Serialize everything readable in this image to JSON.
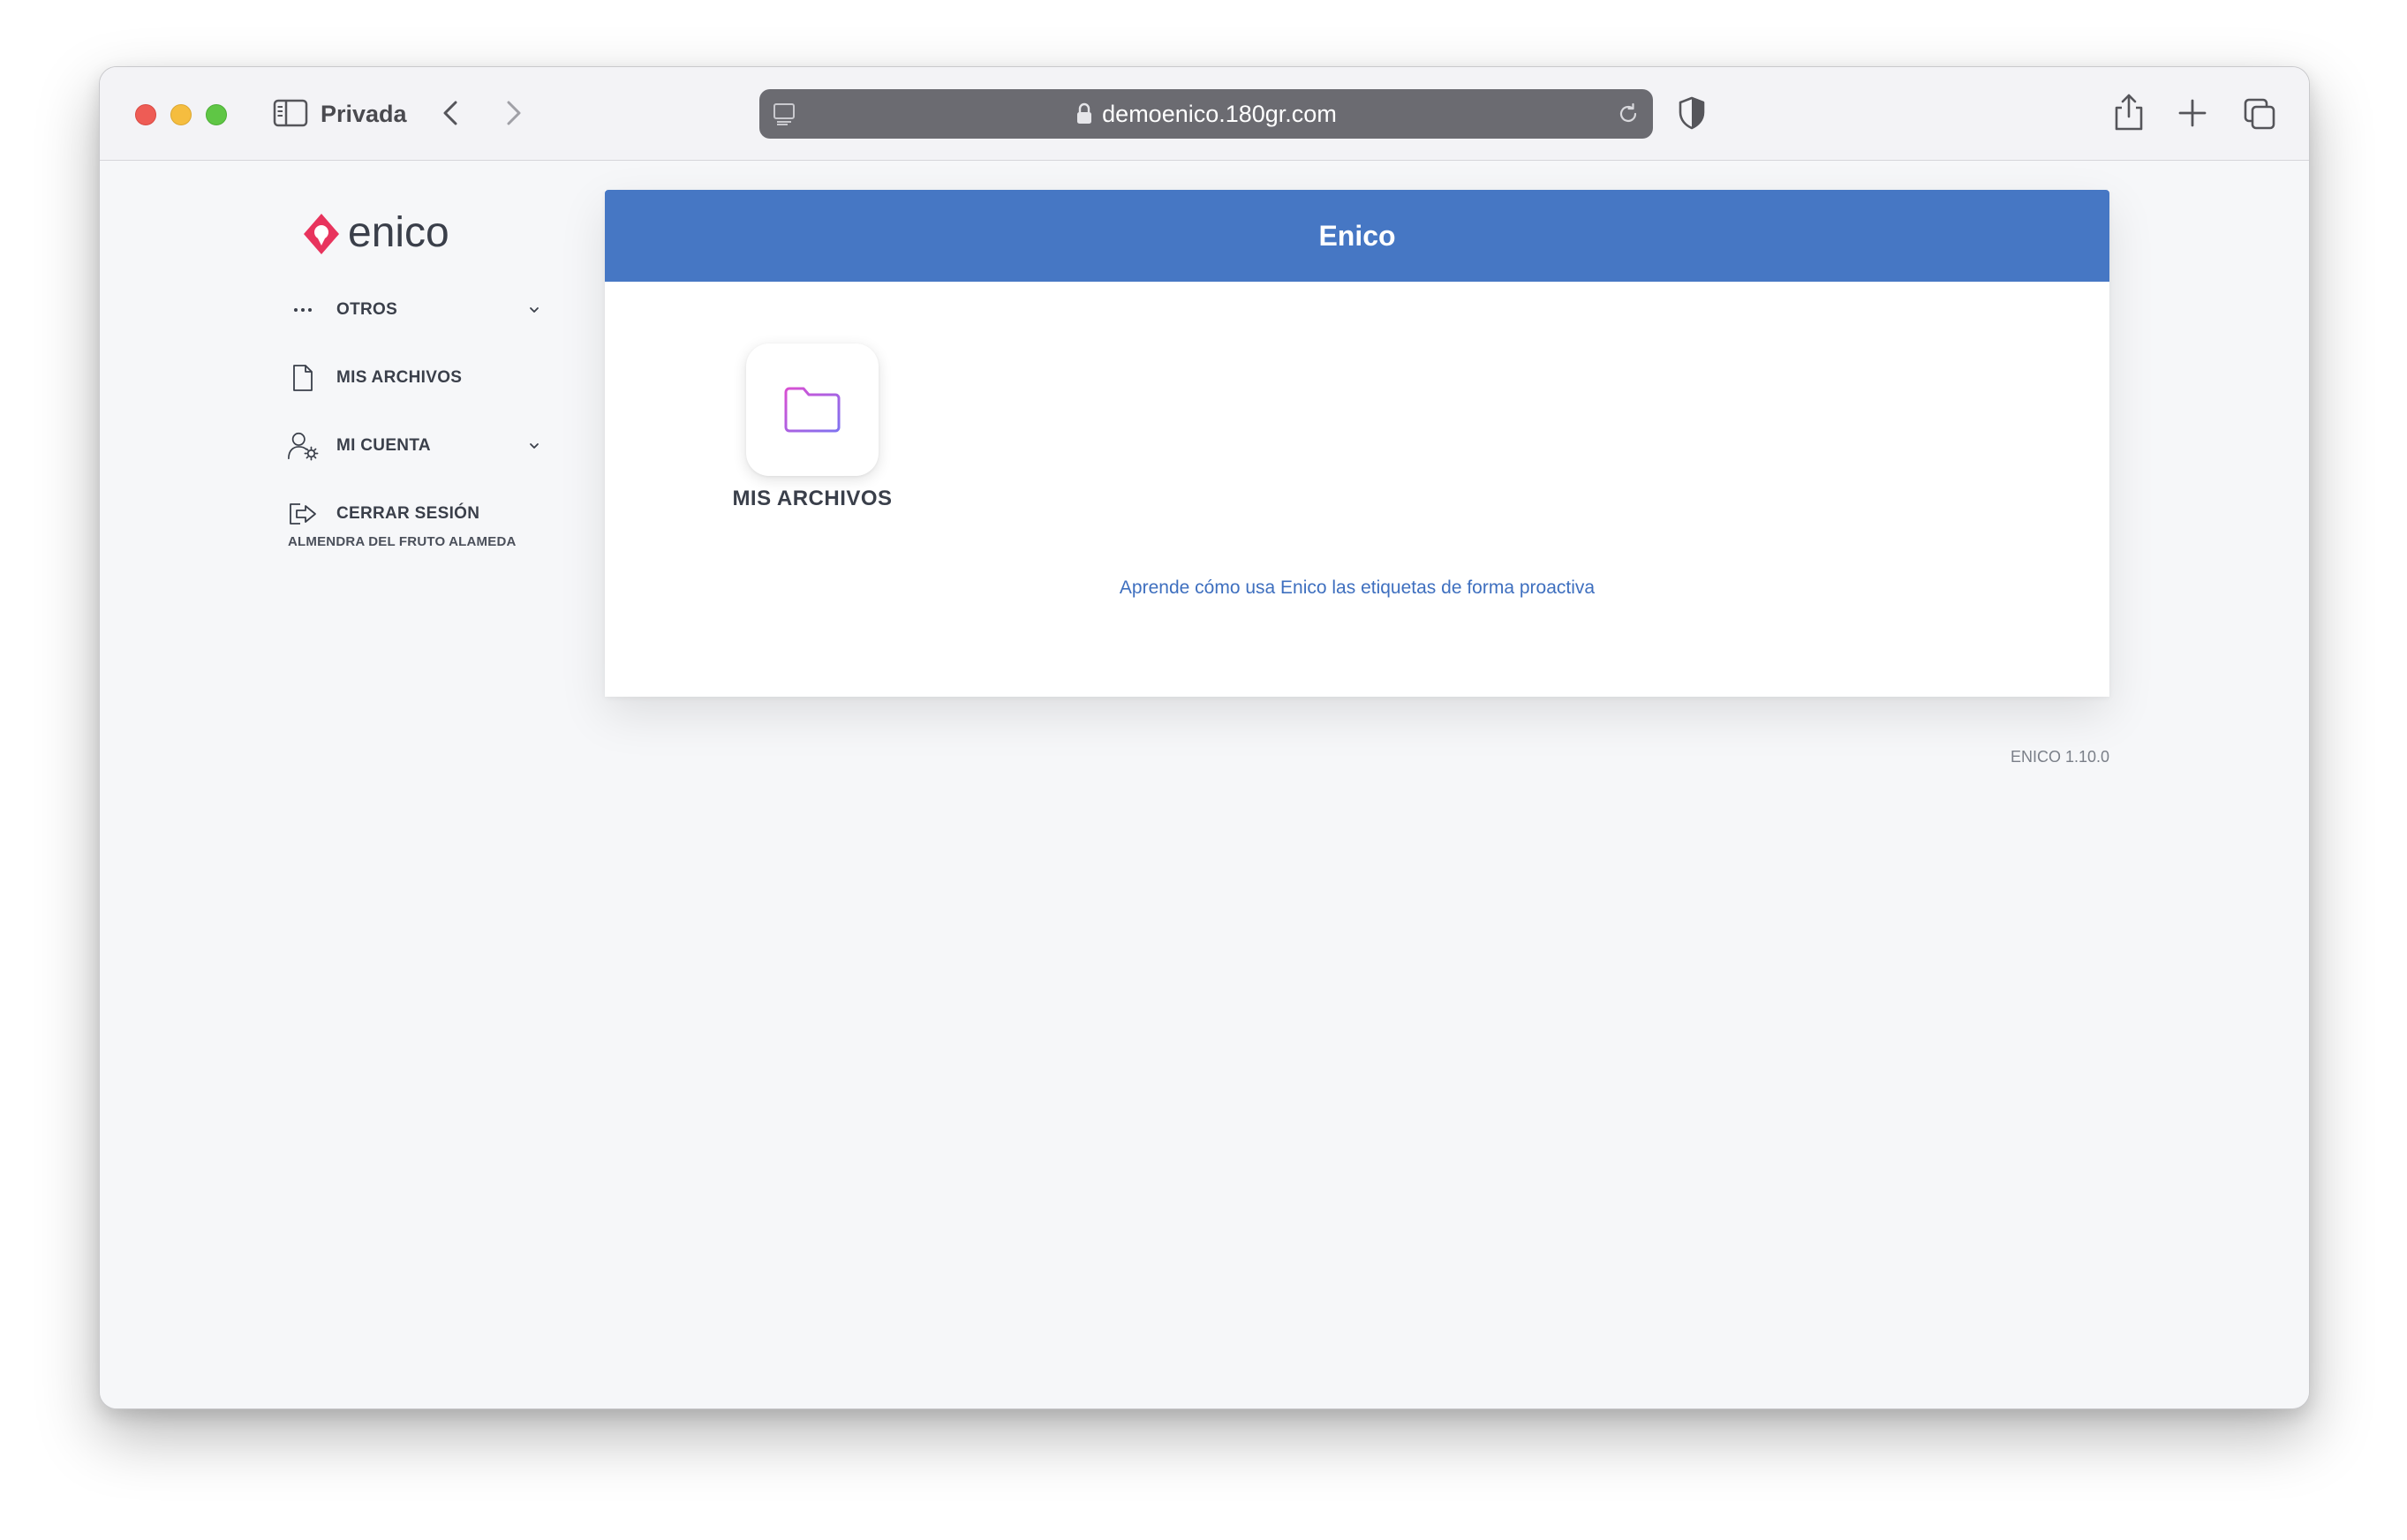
{
  "browser": {
    "mode_label": "Privada",
    "url": "demoenico.180gr.com"
  },
  "brand": {
    "name": "enico",
    "accent": "#e8345d"
  },
  "sidebar": {
    "items": [
      {
        "label": "OTROS"
      },
      {
        "label": "MIS ARCHIVOS"
      },
      {
        "label": "MI CUENTA"
      },
      {
        "label": "CERRAR SESIÓN"
      }
    ],
    "user_name": "ALMENDRA DEL FRUTO ALAMEDA"
  },
  "card": {
    "title": "Enico",
    "header_color": "#4677c4",
    "apps": [
      {
        "label": "MIS ARCHIVOS",
        "icon": "folder-icon"
      }
    ],
    "help_link": "Aprende cómo usa Enico las etiquetas de forma proactiva"
  },
  "footer": {
    "version": "ENICO 1.10.0"
  }
}
